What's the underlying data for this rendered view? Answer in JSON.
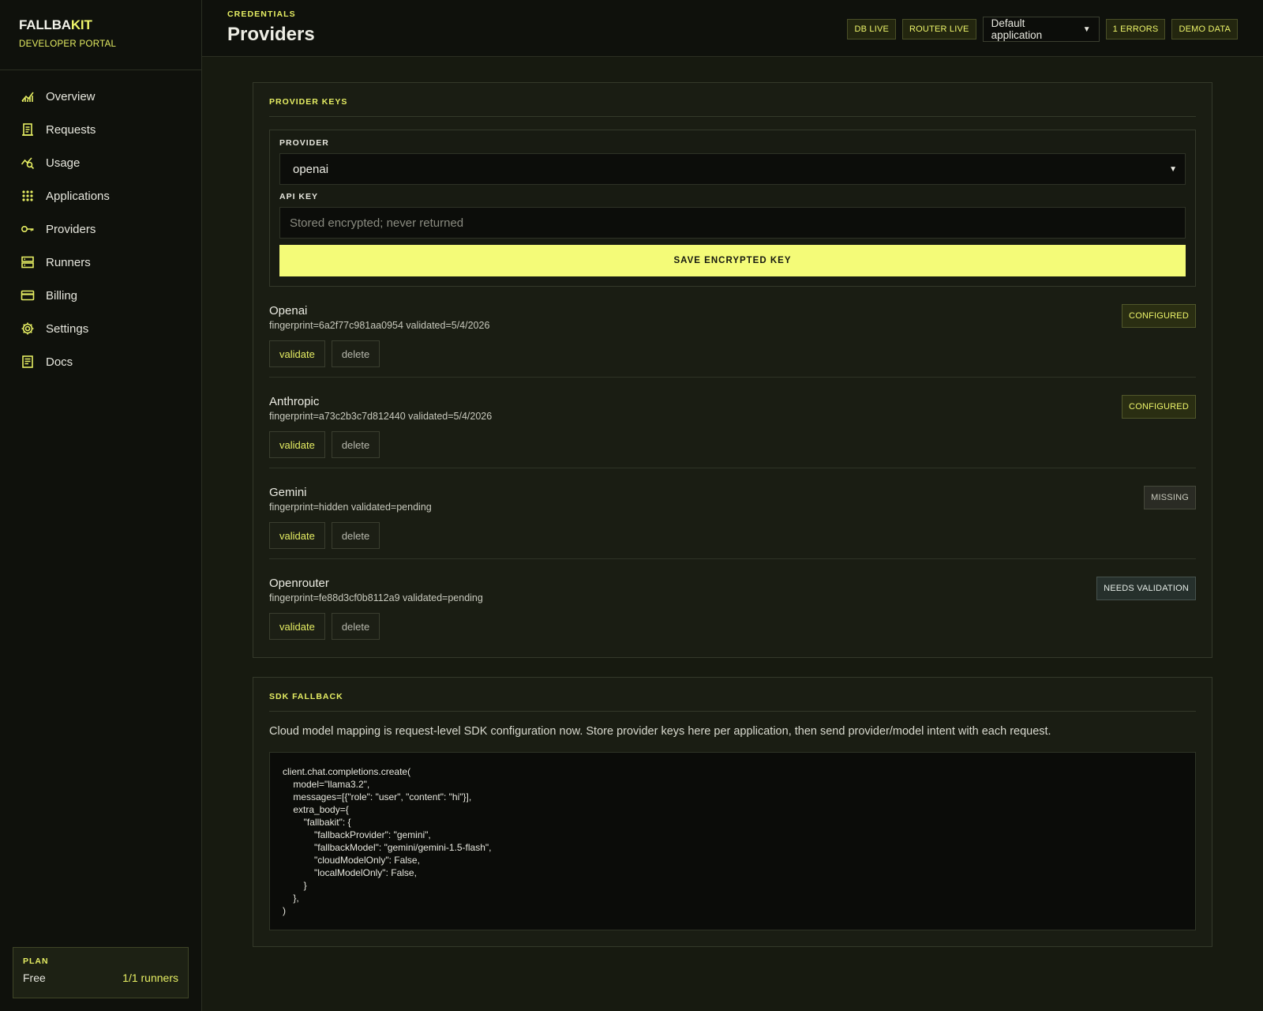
{
  "brand": {
    "name_part1": "FALLBA",
    "name_part2": "KIT",
    "subtitle": "DEVELOPER PORTAL"
  },
  "sidebar": {
    "items": [
      {
        "label": "Overview",
        "icon": "chart-icon"
      },
      {
        "label": "Requests",
        "icon": "receipt-icon"
      },
      {
        "label": "Usage",
        "icon": "trend-search-icon"
      },
      {
        "label": "Applications",
        "icon": "grid-icon"
      },
      {
        "label": "Providers",
        "icon": "key-icon"
      },
      {
        "label": "Runners",
        "icon": "server-icon"
      },
      {
        "label": "Billing",
        "icon": "credit-card-icon"
      },
      {
        "label": "Settings",
        "icon": "gear-icon"
      },
      {
        "label": "Docs",
        "icon": "document-icon"
      }
    ],
    "plan": {
      "label": "PLAN",
      "name": "Free",
      "runners": "1/1 runners"
    }
  },
  "header": {
    "breadcrumb": "CREDENTIALS",
    "title": "Providers",
    "badges": {
      "db": "DB LIVE",
      "router": "ROUTER LIVE",
      "errors": "1 ERRORS",
      "demo": "DEMO DATA"
    },
    "app_select": "Default application"
  },
  "provider_keys": {
    "heading": "PROVIDER KEYS",
    "provider_label": "PROVIDER",
    "provider_value": "openai",
    "api_key_label": "API KEY",
    "api_key_placeholder": "Stored encrypted; never returned",
    "save_label": "SAVE ENCRYPTED KEY",
    "rows": [
      {
        "name": "Openai",
        "meta": "fingerprint=6a2f77c981aa0954 validated=5/4/2026",
        "status": "CONFIGURED",
        "status_kind": "configured"
      },
      {
        "name": "Anthropic",
        "meta": "fingerprint=a73c2b3c7d812440 validated=5/4/2026",
        "status": "CONFIGURED",
        "status_kind": "configured"
      },
      {
        "name": "Gemini",
        "meta": "fingerprint=hidden validated=pending",
        "status": "MISSING",
        "status_kind": "missing"
      },
      {
        "name": "Openrouter",
        "meta": "fingerprint=fe88d3cf0b8112a9 validated=pending",
        "status": "NEEDS VALIDATION",
        "status_kind": "needs"
      }
    ],
    "validate_label": "validate",
    "delete_label": "delete"
  },
  "sdk_fallback": {
    "heading": "SDK FALLBACK",
    "description": "Cloud model mapping is request-level SDK configuration now. Store provider keys here per application, then send provider/model intent with each request.",
    "code": "client.chat.completions.create(\n    model=\"llama3.2\",\n    messages=[{\"role\": \"user\", \"content\": \"hi\"}],\n    extra_body={\n        \"fallbakit\": {\n            \"fallbackProvider\": \"gemini\",\n            \"fallbackModel\": \"gemini/gemini-1.5-flash\",\n            \"cloudModelOnly\": False,\n            \"localModelOnly\": False,\n        }\n    },\n)"
  },
  "colors": {
    "accent": "#eef56a",
    "background": "#171a10",
    "sidebar": "#0f110c",
    "button": "#f4fb78"
  }
}
